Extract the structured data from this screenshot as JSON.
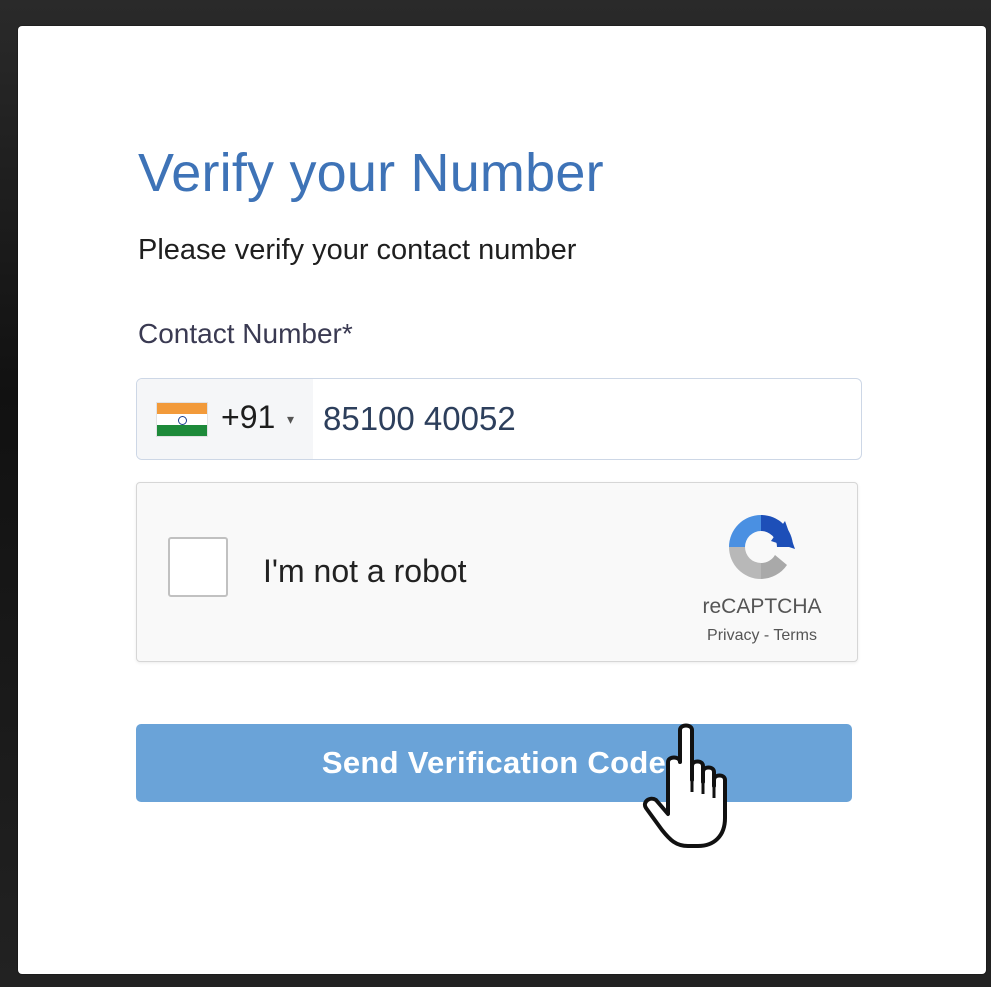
{
  "form": {
    "title": "Verify your Number",
    "subtitle": "Please verify your contact number",
    "field_label": "Contact Number*",
    "phone": {
      "country_flag": "india-flag-icon",
      "dial_code": "+91",
      "caret": "▾",
      "value": "85100 40052"
    },
    "captcha": {
      "label": "I'm not a robot",
      "brand": "reCAPTCHA",
      "privacy": "Privacy",
      "separator": "-",
      "terms": "Terms",
      "checked": false
    },
    "send_button_label": "Send Verification Code",
    "cursor_icon": "hand-pointer-icon"
  },
  "colors": {
    "title": "#3e73b7",
    "button": "#6aa3d8",
    "button_text": "#ffffff"
  }
}
